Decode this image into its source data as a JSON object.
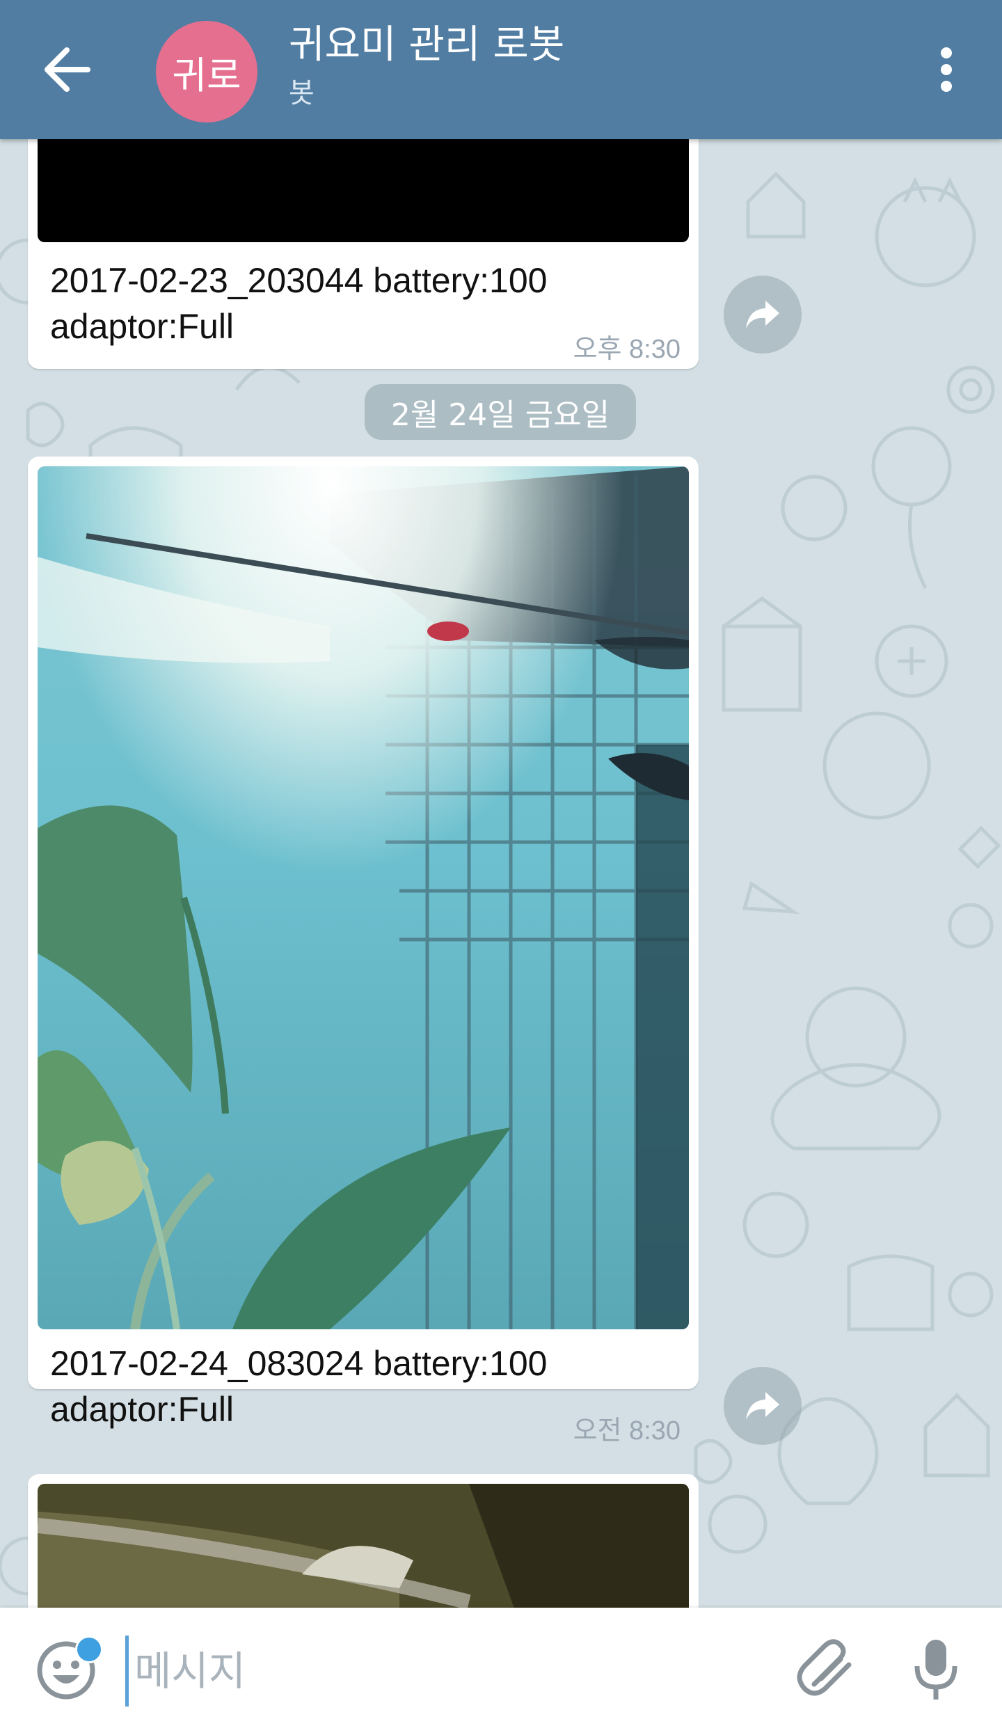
{
  "header": {
    "avatar_text": "귀로",
    "title": "귀요미 관리 로봇",
    "subtitle": "봇",
    "back_icon": "arrow-left-icon",
    "menu_icon": "more-vert-icon"
  },
  "messages": [
    {
      "caption": "2017-02-23_203044 battery:100\nadaptor:Full",
      "time": "오후 8:30"
    },
    {
      "caption": "2017-02-24_083024 battery:100\nadaptor:Full",
      "time": "오전 8:30"
    }
  ],
  "date_separator": "2월 24일 금요일",
  "input": {
    "placeholder": "메시지",
    "emoji_icon": "emoji-icon",
    "attach_icon": "paperclip-icon",
    "mic_icon": "microphone-icon"
  },
  "colors": {
    "header": "#517da2",
    "avatar": "#e56f8e",
    "chat_bg": "#d3dfe4"
  }
}
